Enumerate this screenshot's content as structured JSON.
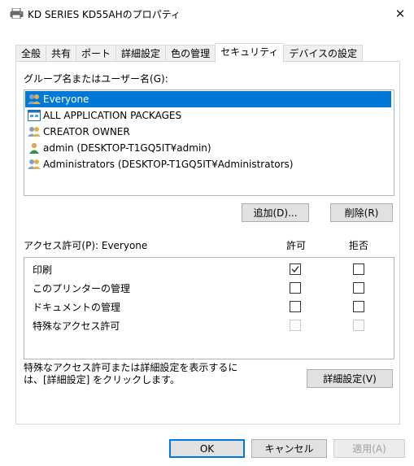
{
  "window": {
    "title": "KD SERIES KD55AHのプロパティ",
    "icon": "printer-icon",
    "close_glyph": "✕"
  },
  "tabs": [
    {
      "label": "全般",
      "active": false
    },
    {
      "label": "共有",
      "active": false
    },
    {
      "label": "ポート",
      "active": false
    },
    {
      "label": "詳細設定",
      "active": false
    },
    {
      "label": "色の管理",
      "active": false
    },
    {
      "label": "セキュリティ",
      "active": true
    },
    {
      "label": "デバイスの設定",
      "active": false
    }
  ],
  "security": {
    "groups_label": "グループ名またはユーザー名(G):",
    "groups": [
      {
        "name": "Everyone",
        "icon": "group-icon",
        "selected": true
      },
      {
        "name": "ALL APPLICATION PACKAGES",
        "icon": "app-packages-icon",
        "selected": false
      },
      {
        "name": "CREATOR OWNER",
        "icon": "group-icon",
        "selected": false
      },
      {
        "name": "admin (DESKTOP-T1GQ5IT¥admin)",
        "icon": "user-icon",
        "selected": false
      },
      {
        "name": "Administrators (DESKTOP-T1GQ5IT¥Administrators)",
        "icon": "group-icon",
        "selected": false
      }
    ],
    "add_button": "追加(D)...",
    "remove_button": "削除(R)",
    "permissions_label": "アクセス許可(P): Everyone",
    "allow_header": "許可",
    "deny_header": "拒否",
    "permissions": [
      {
        "name": "印刷",
        "allow": true,
        "deny": false,
        "enabled": true
      },
      {
        "name": "このプリンターの管理",
        "allow": false,
        "deny": false,
        "enabled": true
      },
      {
        "name": "ドキュメントの管理",
        "allow": false,
        "deny": false,
        "enabled": true
      },
      {
        "name": "特殊なアクセス許可",
        "allow": false,
        "deny": false,
        "enabled": false
      }
    ],
    "advanced_note": "特殊なアクセス許可または詳細設定を表示するには、[詳細設定] をクリックします。",
    "advanced_button": "詳細設定(V)"
  },
  "footer": {
    "ok": "OK",
    "cancel": "キャンセル",
    "apply": "適用(A)"
  },
  "colors": {
    "accent": "#0078d7",
    "selection_bg": "#0078d7",
    "button_bg": "#e1e1e1",
    "border": "#adadad"
  }
}
